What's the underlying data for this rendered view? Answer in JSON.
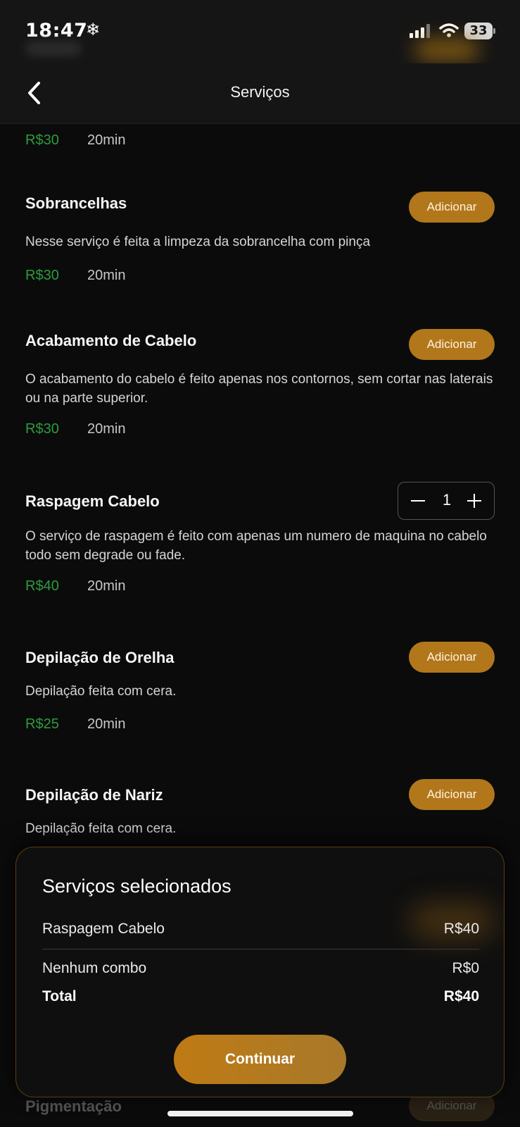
{
  "status_bar": {
    "time": "18:47",
    "battery": "33"
  },
  "header": {
    "title": "Serviços"
  },
  "services": [
    {
      "name": "",
      "description": "",
      "price": "R$30",
      "duration": "20min",
      "action": ""
    },
    {
      "name": "Sobrancelhas",
      "description": "Nesse serviço é feita a limpeza da sobrancelha com pinça",
      "price": "R$30",
      "duration": "20min",
      "action": "Adicionar"
    },
    {
      "name": "Acabamento de Cabelo",
      "description": "O acabamento do cabelo é feito apenas nos contornos, sem cortar nas laterais ou na parte superior.",
      "price": "R$30",
      "duration": "20min",
      "action": "Adicionar"
    },
    {
      "name": "Raspagem Cabelo",
      "description": "O serviço de raspagem é feito com apenas um numero de maquina no cabelo todo sem degrade ou fade.",
      "price": "R$40",
      "duration": "20min",
      "quantity": "1"
    },
    {
      "name": "Depilação de Orelha",
      "description": "Depilação feita com cera.",
      "price": "R$25",
      "duration": "20min",
      "action": "Adicionar"
    },
    {
      "name": "Depilação de Nariz",
      "description": "Depilação feita com cera.",
      "action": "Adicionar"
    },
    {
      "name": "Pigmentação",
      "action": "Adicionar"
    }
  ],
  "selected": {
    "title": "Serviços selecionados",
    "items": [
      {
        "name": "Raspagem Cabelo",
        "price": "R$40"
      }
    ],
    "combo": {
      "label": "Nenhum combo",
      "price": "R$0"
    },
    "total": {
      "label": "Total",
      "price": "R$40"
    },
    "continue_label": "Continuar"
  },
  "colors": {
    "accent": "#b2771b",
    "price": "#2e9b3e",
    "background": "#0b0b0b"
  }
}
